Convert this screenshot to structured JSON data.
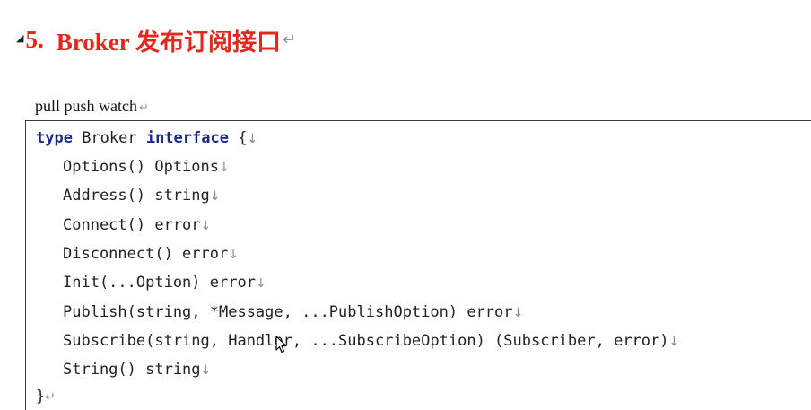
{
  "heading": {
    "toggle": "◢",
    "number": "5.",
    "title": "Broker 发布订阅接口",
    "para_mark": "↵"
  },
  "subtitle": {
    "text": "pull push watch",
    "para_mark": "↵"
  },
  "code": {
    "line0": {
      "kw1": "type",
      "name": " Broker ",
      "kw2": "interface",
      "rest": " {",
      "mark": "↓"
    },
    "lines": [
      {
        "text": "Options() Options",
        "mark": "↓"
      },
      {
        "text": "Address() string",
        "mark": "↓"
      },
      {
        "text": "Connect() error",
        "mark": "↓"
      },
      {
        "text": "Disconnect() error",
        "mark": "↓"
      },
      {
        "text": "Init(...Option) error",
        "mark": "↓"
      },
      {
        "text": "Publish(string, *Message, ...PublishOption) error",
        "mark": "↓"
      },
      {
        "text": "Subscribe(string, Handler, ...SubscribeOption) (Subscriber, error)",
        "mark": "↓"
      },
      {
        "text": "String() string",
        "mark": "↓"
      }
    ],
    "closing": {
      "text": "}",
      "mark": "↵"
    }
  }
}
